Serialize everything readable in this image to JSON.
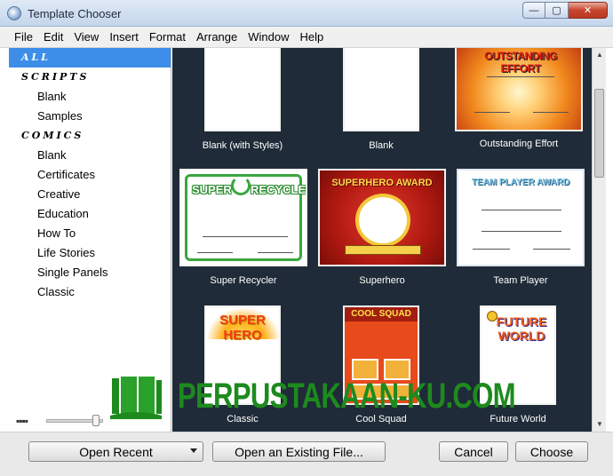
{
  "window": {
    "title": "Template Chooser",
    "controls": {
      "minimize": "—",
      "maximize": "▢",
      "close": "✕"
    }
  },
  "menu": [
    "File",
    "Edit",
    "View",
    "Insert",
    "Format",
    "Arrange",
    "Window",
    "Help"
  ],
  "sidebar": {
    "all_label": "ALL",
    "scripts_label": "SCRIPTS",
    "scripts_items": [
      "Blank",
      "Samples"
    ],
    "comics_label": "COMICS",
    "comics_items": [
      "Blank",
      "Certificates",
      "Creative",
      "Education",
      "How To",
      "Life Stories",
      "Single Panels",
      "Classic"
    ]
  },
  "templates": {
    "blank_styles": {
      "caption": "Blank (with Styles)"
    },
    "blank": {
      "caption": "Blank"
    },
    "outstanding": {
      "caption": "Outstanding Effort",
      "art_title": "OUTSTANDING EFFORT"
    },
    "recycler": {
      "caption": "Super Recycler",
      "art_super": "SUPER",
      "art_recycler": "RECYCLER"
    },
    "superhero": {
      "caption": "Superhero",
      "art_title": "SUPERHERO AWARD"
    },
    "team": {
      "caption": "Team Player",
      "art_title": "TEAM PLAYER AWARD"
    },
    "classic": {
      "caption": "Classic",
      "art_title": "SUPER HERO"
    },
    "cool": {
      "caption": "Cool Squad",
      "art_title": "COOL SQUAD"
    },
    "future": {
      "caption": "Future World",
      "art_title": "FUTURE WORLD"
    }
  },
  "watermark": {
    "text": "PERPUSTAKAAN-KU.COM"
  },
  "footer": {
    "open_recent": "Open Recent",
    "open_existing": "Open an Existing File...",
    "cancel": "Cancel",
    "choose": "Choose"
  },
  "colors": {
    "selection": "#3d8ee8",
    "grid_background": "#1f2b38",
    "watermark_green": "#1e8a1e"
  }
}
